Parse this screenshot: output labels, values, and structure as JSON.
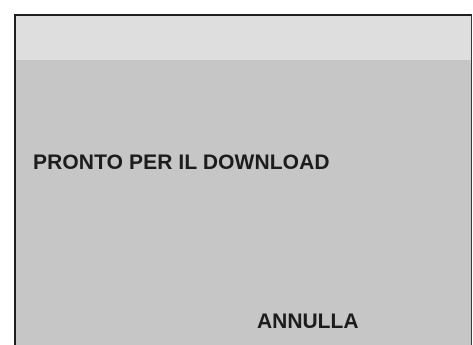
{
  "dialog": {
    "status_text": "PRONTO PER IL DOWNLOAD",
    "cancel_label": "ANNULLA"
  },
  "colors": {
    "panel": "#c6c6c6",
    "top_band": "#dedede",
    "text": "#1c1c1c"
  }
}
